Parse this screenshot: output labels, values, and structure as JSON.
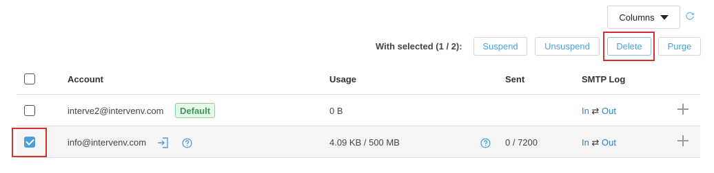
{
  "toolbar": {
    "columns_label": "Columns",
    "with_selected_label": "With selected (1 / 2):",
    "actions": [
      {
        "label": "Suspend"
      },
      {
        "label": "Unsuspend"
      },
      {
        "label": "Delete"
      },
      {
        "label": "Purge"
      }
    ]
  },
  "table": {
    "headers": [
      "Account",
      "Usage",
      "Sent",
      "SMTP Log"
    ],
    "rows": [
      {
        "checked": false,
        "account": "interve2@intervenv.com",
        "badge": "Default",
        "usage": "0 B",
        "sent": "",
        "smtp_in": "In",
        "smtp_arrow": "⇄",
        "smtp_out": "Out"
      },
      {
        "checked": true,
        "account": "info@intervenv.com",
        "badge": "",
        "usage": "4.09 KB / 500 MB",
        "sent": "0 / 7200",
        "smtp_in": "In",
        "smtp_arrow": "⇄",
        "smtp_out": "Out"
      }
    ]
  },
  "colors": {
    "accent": "#4a9fd8",
    "highlight": "#d32f2f",
    "badge_green": "#3c9a57"
  }
}
